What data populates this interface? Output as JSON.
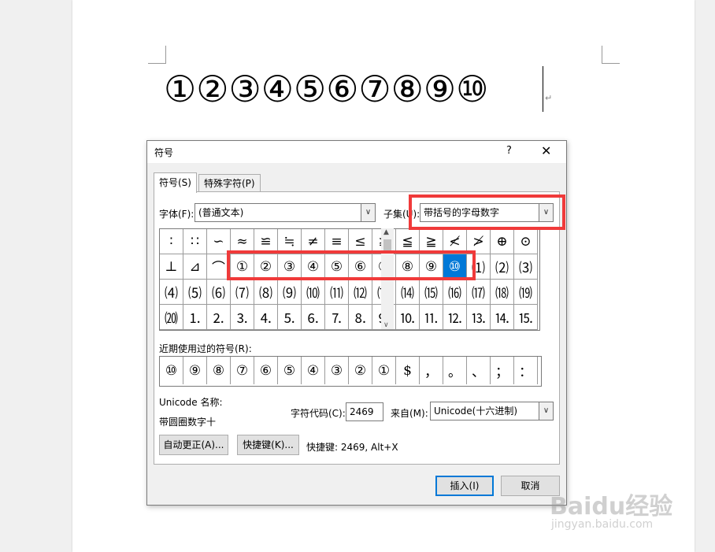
{
  "document": {
    "text": "①②③④⑤⑥⑦⑧⑨⑩",
    "paragraph_mark": "↵"
  },
  "dialog": {
    "title": "符号",
    "help": "?",
    "close": "✕",
    "tabs": [
      {
        "label": "符号(S)",
        "active": true
      },
      {
        "label": "特殊字符(P)",
        "active": false
      }
    ],
    "font_label": "字体(F):",
    "font_value": "(普通文本)",
    "subset_label": "子集(U):",
    "subset_value": "带括号的字母数字",
    "grid_rows": [
      [
        "∶",
        "∷",
        "∽",
        "≈",
        "≌",
        "≒",
        "≠",
        "≡",
        "≤",
        "≥",
        "≦",
        "≧",
        "≮",
        "≯",
        "⊕",
        "⊙"
      ],
      [
        "⊥",
        "⊿",
        "⌒",
        "①",
        "②",
        "③",
        "④",
        "⑤",
        "⑥",
        "⑦",
        "⑧",
        "⑨",
        "⑩",
        "⑴",
        "⑵",
        "⑶"
      ],
      [
        "⑷",
        "⑸",
        "⑹",
        "⑺",
        "⑻",
        "⑼",
        "⑽",
        "⑾",
        "⑿",
        "⒀",
        "⒁",
        "⒂",
        "⒃",
        "⒄",
        "⒅",
        "⒆"
      ],
      [
        "⒇",
        "⒈",
        "⒉",
        "⒊",
        "⒋",
        "⒌",
        "⒍",
        "⒎",
        "⒏",
        "⒐",
        "⒑",
        "⒒",
        "⒓",
        "⒔",
        "⒕",
        "⒖"
      ]
    ],
    "selected_row": 1,
    "selected_col": 12,
    "recent_label": "近期使用过的符号(R):",
    "recent": [
      "⑩",
      "⑨",
      "⑧",
      "⑦",
      "⑥",
      "⑤",
      "④",
      "③",
      "②",
      "①",
      "$",
      "，",
      "。",
      "、",
      "；",
      "："
    ],
    "unicode_name_label": "Unicode 名称:",
    "unicode_name": "带圆圈数字十",
    "char_code_label": "字符代码(C):",
    "char_code": "2469",
    "from_label": "来自(M):",
    "from_value": "Unicode(十六进制)",
    "autocorrect_button": "自动更正(A)...",
    "shortcut_button": "快捷键(K)...",
    "shortcut_text": "快捷键: 2469, Alt+X",
    "insert_button": "插入(I)",
    "cancel_button": "取消"
  },
  "watermark": {
    "brand": "Baidu经验",
    "url": "jingyan.baidu.com"
  },
  "colors": {
    "highlight": "#f03a3a",
    "selection": "#0078d7"
  }
}
